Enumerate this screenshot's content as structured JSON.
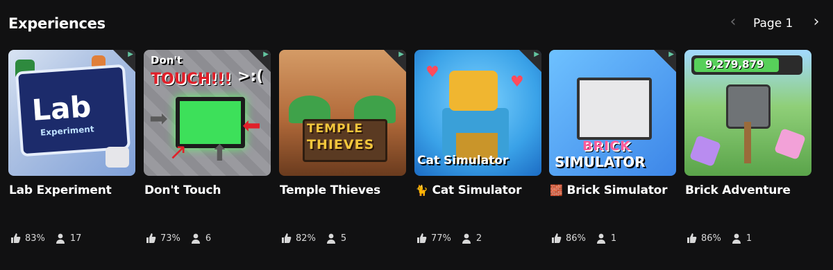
{
  "section": {
    "title": "Experiences",
    "page_label": "Page 1"
  },
  "cards": [
    {
      "name": "Lab Experiment",
      "emoji": "",
      "rating": "83%",
      "players": "17",
      "art_text": [
        "Lab",
        "Experiment"
      ]
    },
    {
      "name": "Don't Touch",
      "emoji": "",
      "rating": "73%",
      "players": "6",
      "art_text": [
        "Don't",
        "TOUCH!!!",
        ">:("
      ]
    },
    {
      "name": "Temple Thieves",
      "emoji": "",
      "rating": "82%",
      "players": "5",
      "art_text": [
        "TEMPLE",
        "THIEVES"
      ]
    },
    {
      "name": "Cat Simulator",
      "emoji": "🐈",
      "rating": "77%",
      "players": "2",
      "art_text": [
        "Cat Simulator"
      ]
    },
    {
      "name": "Brick Simulator",
      "emoji": "🧱",
      "rating": "86%",
      "players": "1",
      "art_text": [
        "BRICK",
        "SIMULATOR"
      ]
    },
    {
      "name": "Brick Adventure",
      "emoji": "",
      "rating": "86%",
      "players": "1",
      "art_text": [
        "9,279,879"
      ]
    }
  ],
  "icons": {
    "prev": "chevron-left-icon",
    "next": "chevron-right-icon",
    "rating": "thumbs-up-icon",
    "players": "person-icon"
  },
  "colors": {
    "background": "#111112",
    "text": "#ffffff",
    "disabled_chevron": "#6b6b6d"
  }
}
